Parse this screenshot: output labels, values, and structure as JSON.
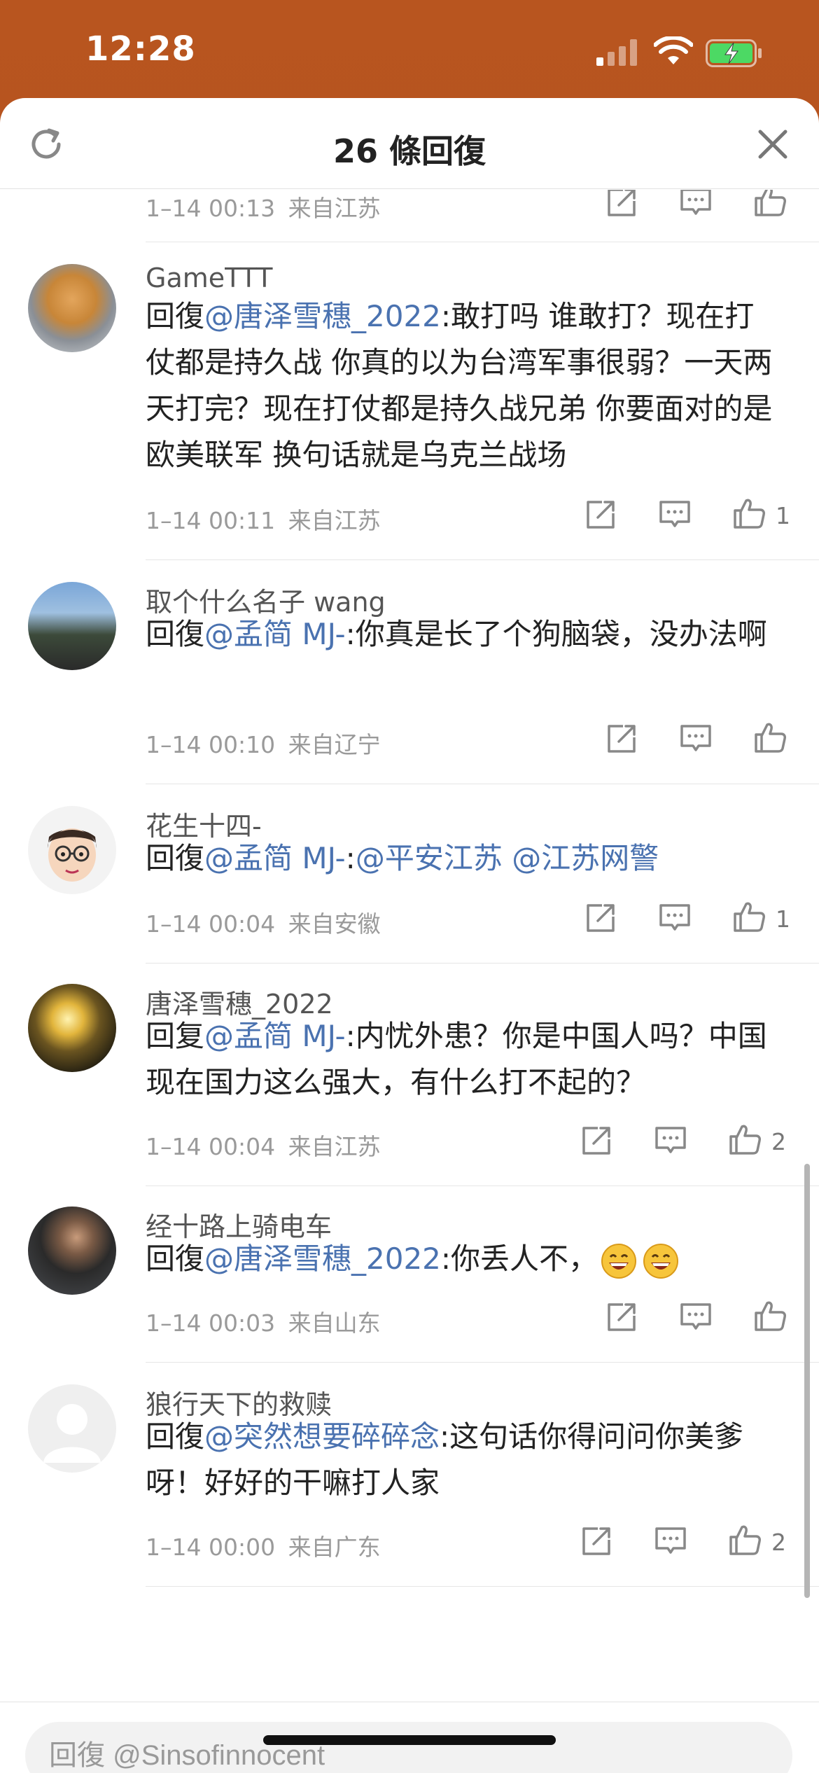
{
  "status_bar": {
    "time": "12:28"
  },
  "header": {
    "title": "26 條回復"
  },
  "first_row": {
    "time": "1–14 00:13",
    "location": "来自江苏"
  },
  "comments": [
    {
      "username": "GameTTT",
      "reply_prefix": "回復",
      "mention": "@唐泽雪穗_2022",
      "text": ":敢打吗 谁敢打？现在打仗都是持久战 你真的以为台湾军事很弱？一天两天打完？现在打仗都是持久战兄弟 你要面对的是欧美联军 换句话就是乌克兰战场",
      "time": "1–14 00:11",
      "location": "来自江苏",
      "likes": "1"
    },
    {
      "username": "取个什么名子 wang",
      "reply_prefix": "回復",
      "mention": "@孟简 MJ-",
      "text": ":你真是长了个狗脑袋，没办法啊",
      "time": "1–14 00:10",
      "location": "来自辽宁",
      "likes": ""
    },
    {
      "username": "花生十四-",
      "reply_prefix": "回復",
      "mention": "@孟简 MJ-",
      "text": ":",
      "mention2": "@平安江苏",
      "mention3": "@江苏网警",
      "time": "1–14 00:04",
      "location": "来自安徽",
      "likes": "1"
    },
    {
      "username": "唐泽雪穗_2022",
      "reply_prefix": "回复",
      "mention": "@孟简 MJ-",
      "text": ":内忧外患？你是中国人吗？中国现在国力这么强大，有什么打不起的？",
      "time": "1–14 00:04",
      "location": "来自江苏",
      "likes": "2"
    },
    {
      "username": "经十路上骑电车",
      "reply_prefix": "回復",
      "mention": "@唐泽雪穗_2022",
      "text": ":你丢人不，",
      "time": "1–14 00:03",
      "location": "来自山东",
      "likes": ""
    },
    {
      "username": "狼行天下的救赎",
      "reply_prefix": "回復",
      "mention": "@突然想要碎碎念",
      "text": ":这句话你得问问你美爹呀！好好的干嘛打人家",
      "time": "1–14 00:00",
      "location": "来自广东",
      "likes": "2"
    }
  ],
  "reply_bar": {
    "placeholder": "回復 @Sinsofinnocent"
  },
  "icons": {
    "refresh": "refresh-icon",
    "close": "close-icon",
    "share": "share-icon",
    "comment": "comment-icon",
    "like": "like-icon"
  },
  "colors": {
    "mention": "#4a72b0",
    "header_bg": "#b8551f"
  }
}
